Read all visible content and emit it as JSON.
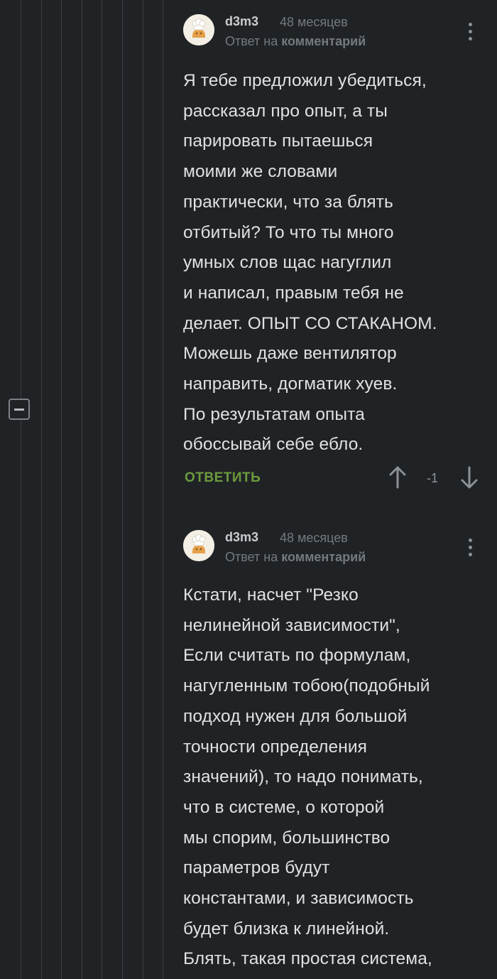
{
  "thread": {
    "collapse_label": "collapse-thread"
  },
  "comments": [
    {
      "author": "d3m3",
      "time": "48 месяцев",
      "reply_prefix": "Ответ на",
      "reply_target": "комментарий",
      "text": "Я тебе предложил убедиться,\nрассказал про опыт, а ты\nпарировать пытаешься\nмоими же словами\nпрактически, что за блять\nотбитый? То что ты много\nумных слов щас нагуглил\nи написал, правым тебя не\nделает. ОПЫТ СО СТАКАНОМ.\nМожешь даже вентилятор\nнаправить, догматик хуев.\nПо результатам опыта\nобоссывай себе ебло.",
      "reply_label": "ОТВЕТИТЬ",
      "rating": "-1"
    },
    {
      "author": "d3m3",
      "time": "48 месяцев",
      "reply_prefix": "Ответ на",
      "reply_target": "комментарий",
      "text": "Кстати, насчет \"Резко\nнелинейной зависимости\",\nЕсли считать по формулам,\nнагугленным тобою(подобный\nподход нужен для большой\nточности определения\nзначений), то надо понимать,\nчто в системе, о которой\nмы спорим, большинство\nпараметров будут\nконстантами, и зависимость\nбудет близка к линейной.\nБлять, такая простая система,"
    }
  ],
  "colors": {
    "background": "#202325",
    "accent": "#6d9b3e",
    "text": "#dfe2e4",
    "muted": "#74797e"
  },
  "icons": [
    "collapse-icon",
    "more-options-icon",
    "upvote-arrow-icon",
    "downvote-arrow-icon",
    "avatar-chef-icon"
  ]
}
